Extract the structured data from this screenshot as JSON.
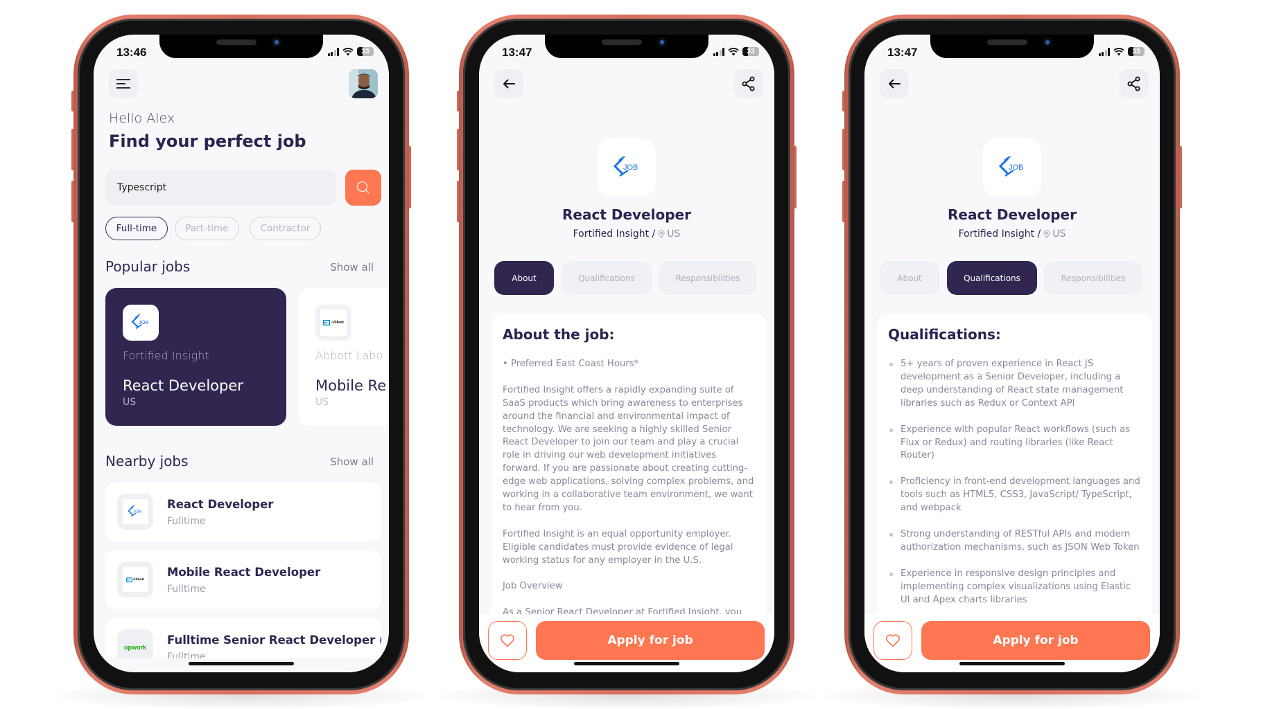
{
  "colors": {
    "accent": "#fe7652",
    "primary_dark": "#302650",
    "frame": "#d8705e",
    "logo_blue": "#1a73e8",
    "upwork_green": "#14a800"
  },
  "screens": [
    {
      "status": {
        "time": "13:46",
        "battery": "33"
      },
      "home": {
        "menu_icon": "hamburger-menu-icon",
        "greeting": "Hello Alex",
        "headline": "Find your perfect job",
        "search": {
          "value": "Typescript",
          "button_icon": "search-icon"
        },
        "filters": [
          {
            "label": "Full-time",
            "active": true
          },
          {
            "label": "Part-time",
            "active": false
          },
          {
            "label": "Contractor",
            "active": false
          }
        ],
        "popular": {
          "title": "Popular jobs",
          "show_all": "Show all",
          "cards": [
            {
              "company": "Fortified Insight",
              "role": "React Developer",
              "location": "US",
              "logo": "job-logo"
            },
            {
              "company": "Abbott Labo",
              "role": "Mobile Re",
              "location": "US",
              "logo": "abbott-logo"
            }
          ]
        },
        "nearby": {
          "title": "Nearby jobs",
          "show_all": "Show all",
          "items": [
            {
              "title": "React Developer",
              "type": "Fulltime",
              "logo": "job-logo"
            },
            {
              "title": "Mobile React Developer",
              "type": "Fulltime",
              "logo": "abbott-logo"
            },
            {
              "title": "Fulltime Senior React Developer (...",
              "type": "Fulltime",
              "logo": "upwork-logo"
            }
          ]
        }
      }
    },
    {
      "status": {
        "time": "13:47",
        "battery": "33"
      },
      "detail": {
        "title": "React Developer",
        "company": "Fortified Insight /",
        "location": "US",
        "tabs": [
          "About",
          "Qualifications",
          "Responsibilities"
        ],
        "active_tab": 0,
        "section_title": "About the job:",
        "paragraphs": [
          "• Preferred East Coast Hours*",
          "Fortified Insight offers a rapidly expanding suite of SaaS products which bring awareness to enterprises around the financial and environmental impact of technology. We are seeking a highly skilled Senior React Developer to join our team and play a crucial role in driving our web development initiatives forward. If you are passionate about creating cutting-edge web applications, solving complex problems, and working in a collaborative team environment, we want to hear from you.",
          "Fortified Insight is an equal opportunity employer. Eligible candidates must provide evidence of legal working status for any employer in the U.S.",
          "Job Overview",
          "As a Senior React Developer at Fortified Insight, you will lead the development of our web application and"
        ],
        "apply_label": "Apply for job"
      }
    },
    {
      "status": {
        "time": "13:47",
        "battery": "33"
      },
      "detail": {
        "title": "React Developer",
        "company": "Fortified Insight /",
        "location": "US",
        "tabs": [
          "About",
          "Qualifications",
          "Responsibilities"
        ],
        "active_tab": 1,
        "section_title": "Qualifications:",
        "bullets": [
          "5+ years of proven experience in React JS development as a Senior Developer, including a deep understanding of React state management libraries such as Redux or Context API",
          "Experience with popular React workflows (such as Flux or Redux) and routing libraries (like React Router)",
          "Proficiency in front-end development languages and tools such as HTML5, CSS3, JavaScript/ TypeScript, and webpack",
          "Strong understanding of RESTful APIs and modern authorization mechanisms, such as JSON Web Token",
          "Experience in responsive design principles and implementing complex visualizations using Elastic UI and Apex charts libraries"
        ],
        "apply_label": "Apply for job"
      }
    }
  ]
}
